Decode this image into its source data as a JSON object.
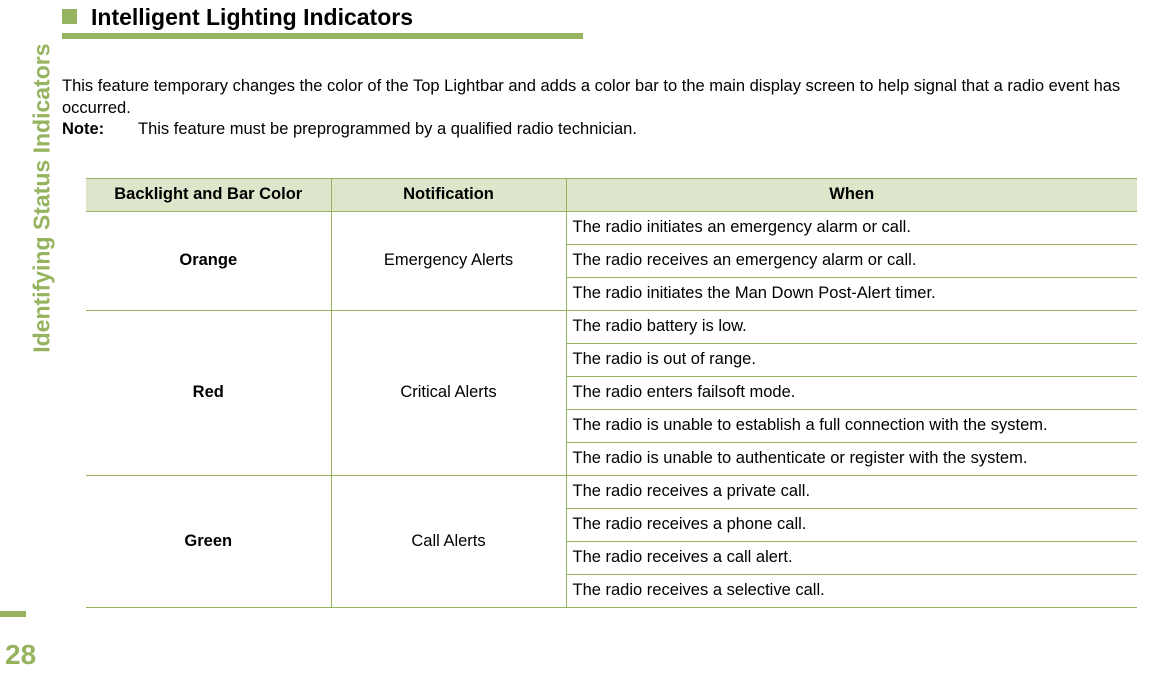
{
  "sidebar": {
    "running_head": "Identifying Status Indicators",
    "page_number": "28"
  },
  "heading": {
    "bullet_icon": "square-bullet-icon",
    "title": "Intelligent Lighting Indicators"
  },
  "body": {
    "intro_paragraph": "This feature temporary changes the color of the Top Lightbar and adds a color bar to the main display screen to help signal that a radio event has occurred.",
    "note_label": "Note:",
    "note_text": "This feature must be preprogrammed by a qualified radio technician."
  },
  "table": {
    "headers": {
      "color": "Backlight and Bar Color",
      "notification": "Notification",
      "when": "When"
    },
    "groups": [
      {
        "color": "Orange",
        "notification": "Emergency Alerts",
        "when": [
          "The radio initiates an emergency alarm or call.",
          "The radio receives an emergency alarm or call.",
          "The radio initiates the Man Down Post-Alert timer."
        ]
      },
      {
        "color": "Red",
        "notification": "Critical Alerts",
        "when": [
          "The radio battery is low.",
          "The radio is out of range.",
          "The radio enters failsoft mode.",
          "The radio is unable to establish a full connection with the system.",
          "The radio is unable to authenticate or register with the system."
        ]
      },
      {
        "color": "Green",
        "notification": "Call Alerts",
        "when": [
          "The radio receives a private call.",
          "The radio receives a phone call.",
          "The radio receives a call alert.",
          "The radio receives a selective call."
        ]
      }
    ]
  },
  "colors": {
    "accent_green": "#96b35f",
    "header_fill": "#dde6cb",
    "text": "#000000"
  }
}
